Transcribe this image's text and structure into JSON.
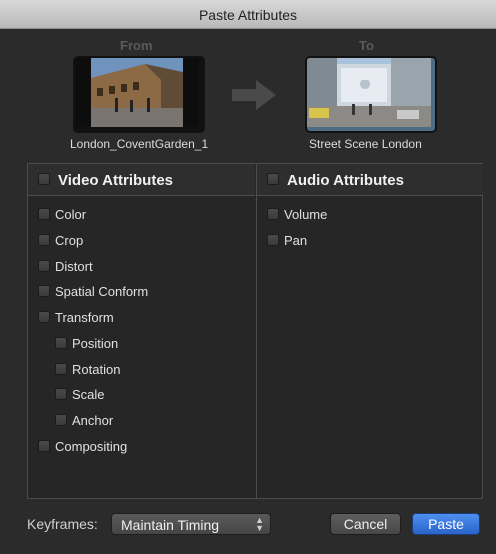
{
  "window": {
    "title": "Paste Attributes"
  },
  "source": {
    "label": "From",
    "clip_name": "London_CoventGarden_1"
  },
  "target": {
    "label": "To",
    "clip_name": "Street Scene London"
  },
  "video": {
    "header": "Video Attributes",
    "items": [
      {
        "label": "Color",
        "checked": false
      },
      {
        "label": "Crop",
        "checked": false
      },
      {
        "label": "Distort",
        "checked": false
      },
      {
        "label": "Spatial Conform",
        "checked": false
      },
      {
        "label": "Transform",
        "checked": false
      },
      {
        "label": "Position",
        "checked": false
      },
      {
        "label": "Rotation",
        "checked": false
      },
      {
        "label": "Scale",
        "checked": false
      },
      {
        "label": "Anchor",
        "checked": false
      },
      {
        "label": "Compositing",
        "checked": false
      }
    ]
  },
  "audio": {
    "header": "Audio Attributes",
    "items": [
      {
        "label": "Volume",
        "checked": false
      },
      {
        "label": "Pan",
        "checked": false
      }
    ]
  },
  "footer": {
    "keyframes_label": "Keyframes:",
    "keyframes_value": "Maintain Timing",
    "cancel_label": "Cancel",
    "paste_label": "Paste"
  },
  "colors": {
    "accent": "#3a78e0",
    "background": "#2b2b2b"
  }
}
